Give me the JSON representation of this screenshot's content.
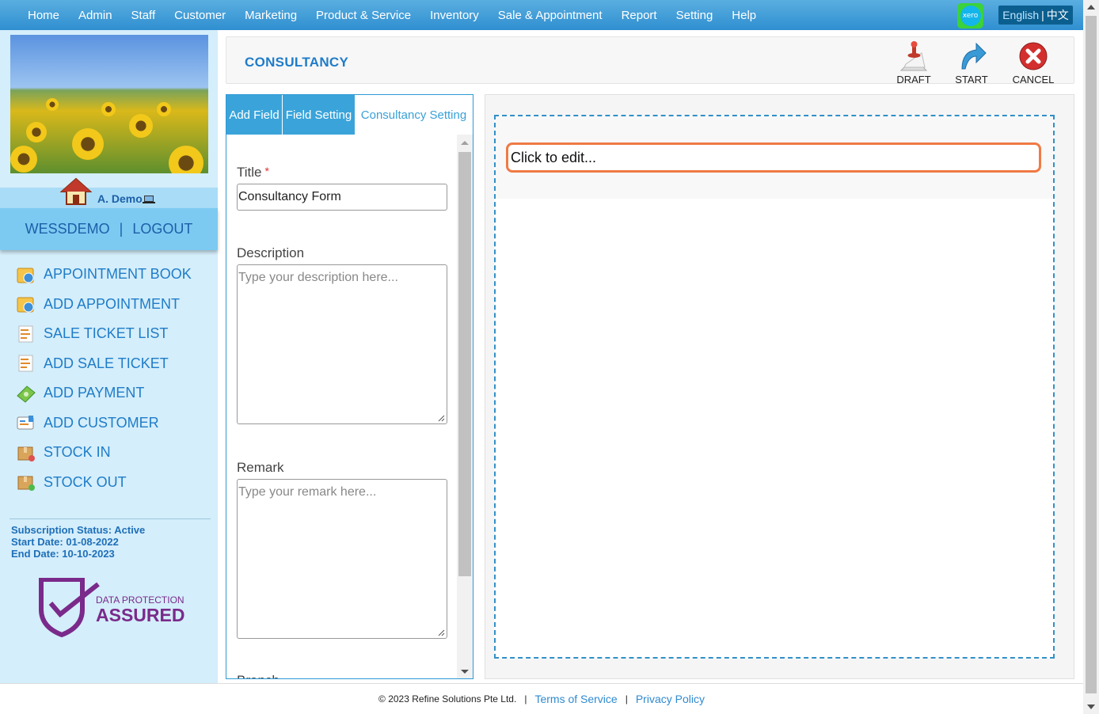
{
  "nav": {
    "items": [
      "Home",
      "Admin",
      "Staff",
      "Customer",
      "Marketing",
      "Product & Service",
      "Inventory",
      "Sale & Appointment",
      "Report",
      "Setting",
      "Help"
    ],
    "xero_label": "xero",
    "lang_english": "English",
    "lang_sep": "|",
    "lang_chinese": "中文"
  },
  "sidebar": {
    "user_name": "A. Demo",
    "account": "WESSDEMO",
    "account_sep": "|",
    "logout": "LOGOUT",
    "menu": [
      {
        "label": "APPOINTMENT BOOK",
        "icon": "calendar-icon"
      },
      {
        "label": "ADD APPOINTMENT",
        "icon": "calendar-icon"
      },
      {
        "label": "SALE TICKET LIST",
        "icon": "receipt-icon"
      },
      {
        "label": "ADD SALE TICKET",
        "icon": "receipt-icon"
      },
      {
        "label": "ADD PAYMENT",
        "icon": "money-icon"
      },
      {
        "label": "ADD CUSTOMER",
        "icon": "customer-card-icon"
      },
      {
        "label": "STOCK IN",
        "icon": "box-in-icon"
      },
      {
        "label": "STOCK OUT",
        "icon": "box-out-icon"
      }
    ],
    "subscription_status": "Subscription Status: Active",
    "start_date": "Start Date: 01-08-2022",
    "end_date": "End Date: 10-10-2023",
    "badge_top": "DATA PROTECTION",
    "badge_bottom": "ASSURED"
  },
  "header": {
    "title": "CONSULTANCY",
    "draft": "DRAFT",
    "start": "START",
    "cancel": "CANCEL"
  },
  "tabs": {
    "add_field": "Add Field",
    "field_setting": "Field Setting",
    "consultancy_setting": "Consultancy Setting"
  },
  "form": {
    "title_label": "Title",
    "title_required": "*",
    "title_value": "Consultancy Form",
    "description_label": "Description",
    "description_placeholder": "Type your description here...",
    "remark_label": "Remark",
    "remark_placeholder": "Type your remark here...",
    "branch_label": "Branch"
  },
  "canvas": {
    "click_to_edit": "Click to edit..."
  },
  "footer": {
    "copyright": "© 2023 Refine Solutions Pte Ltd.",
    "sep": "|",
    "terms": "Terms of Service",
    "privacy": "Privacy Policy"
  },
  "colors": {
    "nav_bar": "#2f8fd0",
    "sidebar_bg": "#d4eefb",
    "accent": "#1f7cc8",
    "edit_outline": "#f07a44"
  }
}
